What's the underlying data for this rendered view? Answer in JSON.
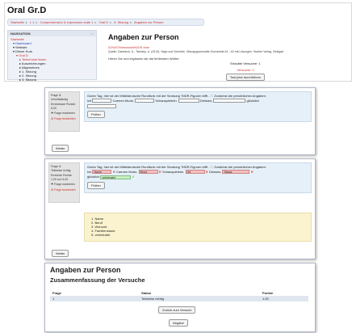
{
  "site": {
    "title": "Oral Gr.D"
  },
  "breadcrumb": [
    "Startseite",
    "L 1",
    "Comprehension & expression orale 1",
    "Oral D",
    "6. Sitzung",
    "Angaben zur Person"
  ],
  "nav": {
    "header": "NAVIGATION",
    "controls": "▫ ▫",
    "items": [
      {
        "label": "Startseite",
        "level": 0,
        "style": "red"
      },
      {
        "label": "Dashboard",
        "level": 1,
        "style": "blue"
      },
      {
        "label": "Website",
        "level": 1,
        "style": "plain"
      },
      {
        "label": "Dieser Kurs",
        "level": 1,
        "style": "plain"
      },
      {
        "label": "Oral D",
        "level": 2,
        "style": "red"
      },
      {
        "label": "Teilnehmer/innen",
        "level": 3,
        "style": "red"
      },
      {
        "label": "Auszeichnungen",
        "level": 3,
        "style": "plain"
      },
      {
        "label": "Allgemeines",
        "level": 3,
        "style": "plain"
      },
      {
        "label": "1. Sitzung",
        "level": 3,
        "style": "plain"
      },
      {
        "label": "2. Sitzung",
        "level": 3,
        "style": "plain"
      },
      {
        "label": "3. Sitzung",
        "level": 3,
        "style": "plain"
      }
    ]
  },
  "main": {
    "title": "Angaben zur Person",
    "file_link": "02%20Telenovela%20S eine",
    "source": "Quelle: Dambeck, U., Tabrizky, U. (2013): Sage und Schreibe. Übungsgrammatik Grundstufe A1 - A2 mit Lösungen. Hueber Verlag, Stuttgart",
    "instruction": "Hören Sie und ergänzen sie die fehlenden Wörter",
    "attempts_label": "Erlaubte Versuche: 1",
    "attempts_value": "Versuche: 2",
    "start_button": "Test jetzt durchführen"
  },
  "q1": {
    "number": "1",
    "status": "Unvollständig",
    "points": "Erreichbare Punkte: 5,00",
    "flag_label": "Frage markieren",
    "edit_label": "Frage bearbeiten",
    "text": "Guten Tag, hier ist der Mitteldeutsche Rundfunk mit der Sendung \"MDR-Figuren trifft ...\". Zunächst die persönlichen Angaben:",
    "prefix": "Ich",
    "after1": "Carmen Modo.",
    "after2": "Schauspielerin.",
    "after3": "Deisses,",
    "after4": "glücklich",
    "check_button": "Prüfen",
    "next_button": "Weiter"
  },
  "q2": {
    "number": "1",
    "status": "Teilweise richtig",
    "points": "Erreichte Punkte 1,00 von 5,00",
    "flag_label": "Frage markieren",
    "edit_label": "Frage bearbeiten",
    "text": "Guten Tag, hier ist der Mitteldeutsche Rundfunk mit der Sendung \"MDR-Figuren trifft ...\". Zunächst die persönlichen Angaben:",
    "prefix": "Ich",
    "answer1": "Name",
    "after1": "Carmen Modo.",
    "answer2": "Beruf",
    "after2": "Schauspielerin.",
    "answer3": "Ort",
    "after3": "Deisses,",
    "answer4": "Status",
    "after4": "glücklich",
    "answer5": "verheiratet",
    "check_button": "Prüfen",
    "feedback": [
      "1. Name",
      "2. Beruf",
      "3. Wohnort",
      "4. Familienstand",
      "5. verheiratet"
    ],
    "next_button": "Weiter"
  },
  "summary": {
    "title": "Angaben zur Person",
    "subtitle": "Zusammenfassung der Versuche",
    "columns": [
      "Frage",
      "Status",
      "Punkte"
    ],
    "rows": [
      [
        "1",
        "Teilweise richtig",
        "1,00"
      ]
    ],
    "back_button": "Zurück zum Versuch",
    "submit_button": "Abgabe"
  }
}
